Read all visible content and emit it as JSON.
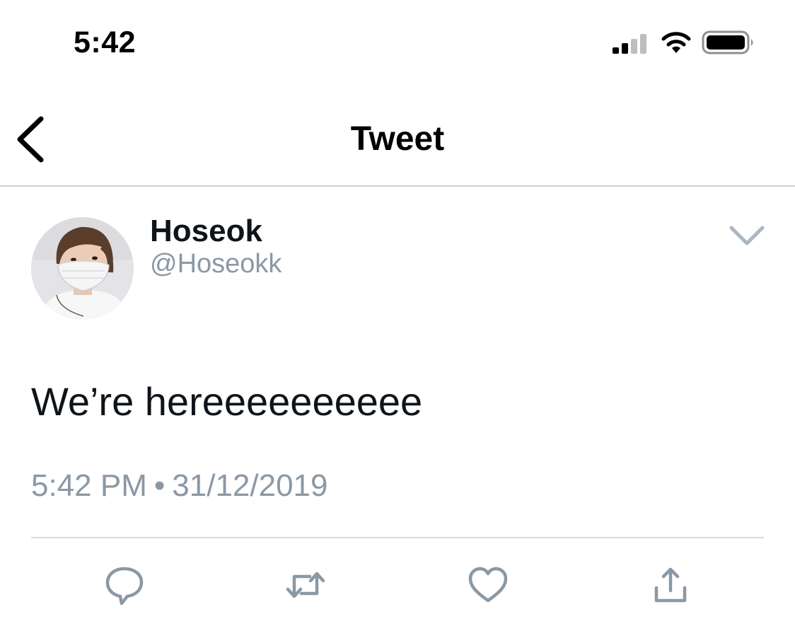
{
  "status_bar": {
    "time": "5:42",
    "icons": [
      "cellular-signal-icon",
      "wifi-icon",
      "battery-icon"
    ]
  },
  "nav": {
    "back_icon": "chevron-left-icon",
    "title": "Tweet"
  },
  "tweet": {
    "author": {
      "display_name": "Hoseok",
      "handle": "@Hoseokk"
    },
    "more_icon": "chevron-down-icon",
    "text": "We’re hereeeeeeeeee",
    "time": "5:42 PM",
    "separator": "•",
    "date": "31/12/2019"
  },
  "actions": [
    "reply-icon",
    "retweet-icon",
    "like-icon",
    "share-icon"
  ],
  "colors": {
    "text_primary": "#0f1419",
    "text_secondary": "#8b98a5",
    "icon_gray": "#8b98a5",
    "divider": "#cfcfd4"
  }
}
